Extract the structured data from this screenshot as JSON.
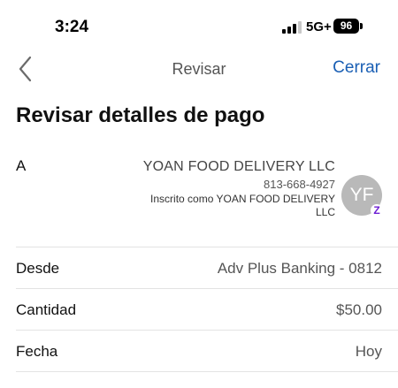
{
  "status_bar": {
    "time": "3:24",
    "network": "5G+",
    "battery": "96"
  },
  "nav": {
    "title": "Revisar",
    "close_label": "Cerrar"
  },
  "page": {
    "title": "Revisar detalles de pago"
  },
  "recipient": {
    "label": "A",
    "name": "YOAN FOOD DELIVERY LLC",
    "phone": "813-668-4927",
    "enrolled_as": "Inscrito como YOAN FOOD DELIVERY LLC",
    "initials": "YF",
    "badge": "Z"
  },
  "details": [
    {
      "label": "Desde",
      "value": "Adv Plus Banking - 0812"
    },
    {
      "label": "Cantidad",
      "value": "$50.00"
    },
    {
      "label": "Fecha",
      "value": "Hoy"
    }
  ],
  "colors": {
    "accent": "#1a5fb4",
    "zelle": "#6d1ed4",
    "avatar": "#b9b9b9"
  }
}
